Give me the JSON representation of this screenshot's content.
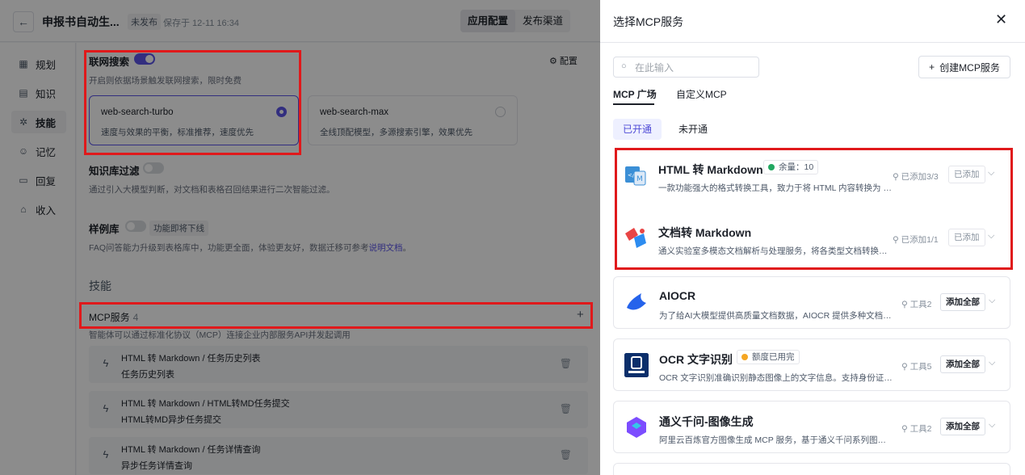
{
  "header": {
    "back_icon": "arrow-left-icon",
    "title": "申报书自动生...",
    "status": "未发布",
    "save_time": "保存于 12-11 16:34",
    "tabs": [
      "应用配置",
      "发布渠道"
    ]
  },
  "sidebar": {
    "items": [
      {
        "label": "规划",
        "icon": "plan-icon"
      },
      {
        "label": "知识",
        "icon": "knowledge-icon"
      },
      {
        "label": "技能",
        "icon": "skill-icon"
      },
      {
        "label": "记忆",
        "icon": "memory-icon"
      },
      {
        "label": "回复",
        "icon": "reply-icon"
      },
      {
        "label": "收入",
        "icon": "income-icon"
      }
    ]
  },
  "main": {
    "web_search": {
      "title": "联网搜索",
      "desc": "开启则依据场景触发联网搜索，限时免费",
      "config_label": "配置",
      "enabled": true,
      "options": [
        {
          "name": "web-search-turbo",
          "desc": "速度与效果的平衡，标准推荐，速度优先",
          "selected": true
        },
        {
          "name": "web-search-max",
          "desc": "全线顶配模型，多源搜索引擎，效果优先",
          "selected": false
        }
      ]
    },
    "kb_filter": {
      "title": "知识库过滤",
      "desc": "通过引入大模型判断，对文档和表格召回结果进行二次智能过滤。",
      "enabled": false
    },
    "examples": {
      "title": "样例库",
      "badge": "功能即将下线",
      "desc": "FAQ问答能力升级到表格库中，功能更全面，体验更友好，数据迁移可参考",
      "link": "说明文档",
      "period": "。",
      "enabled": false
    },
    "skills_title": "技能",
    "mcp": {
      "title": "MCP服务",
      "count": "4",
      "add": "+",
      "desc": "智能体可以通过标准化协议（MCP）连接企业内部服务API并发起调用",
      "tools": [
        {
          "title": "HTML 转 Markdown / 任务历史列表",
          "subtitle": "任务历史列表"
        },
        {
          "title": "HTML 转 Markdown / HTML转MD任务提交",
          "subtitle": "HTML转MD异步任务提交"
        },
        {
          "title": "HTML 转 Markdown / 任务详情查询",
          "subtitle": "异步任务详情查询"
        }
      ]
    }
  },
  "drawer": {
    "title": "选择MCP服务",
    "search_placeholder": "在此输入",
    "create_label": "创建MCP服务",
    "tabs": [
      "MCP 广场",
      "自定义MCP"
    ],
    "filters": [
      "已开通",
      "未开通"
    ],
    "services": [
      {
        "name": "HTML 转 Markdown",
        "badge": "余量：10",
        "badge_color": "#22a861",
        "desc": "一款功能强大的格式转换工具，致力于将 HTML 内容转换为 Markdown 格式",
        "meta": "已添加3/3",
        "action": "已添加",
        "logo": "html-markdown-logo"
      },
      {
        "name": "文档转 Markdown",
        "badge": "",
        "badge_color": "",
        "desc": "通义实验室多模态文档解析与处理服务，将各类型文档转换为 Markdown",
        "meta": "已添加1/1",
        "action": "已添加",
        "logo": "doc-markdown-logo"
      },
      {
        "name": "AIOCR",
        "badge": "",
        "badge_color": "",
        "desc": "为了给AI大模型提供高质量文档数据，AIOCR 提供多种文档识别能力",
        "meta": "工具2",
        "action": "添加全部",
        "logo": "aiocr-logo"
      },
      {
        "name": "OCR 文字识别",
        "badge": "额度已用完",
        "badge_color": "#f5a623",
        "desc": "OCR 文字识别准确识别静态图像上的文字信息。支持身份证识别等",
        "meta": "工具5",
        "action": "添加全部",
        "logo": "ocr-logo"
      },
      {
        "name": "通义千问-图像生成",
        "badge": "",
        "badge_color": "",
        "desc": "阿里云百炼官方图像生成 MCP 服务，基于通义千问系列图像生成模型",
        "meta": "工具2",
        "action": "添加全部",
        "logo": "qwen-image-logo"
      }
    ]
  }
}
